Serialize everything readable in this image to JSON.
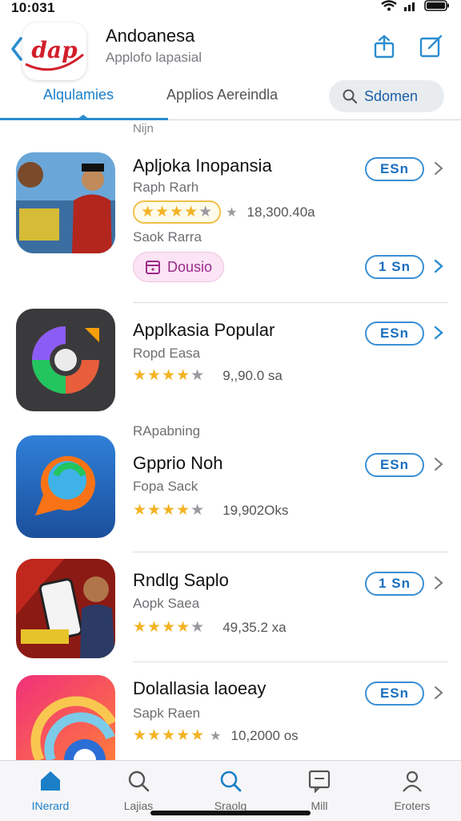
{
  "status_bar": {
    "time": "10:031"
  },
  "header": {
    "title": "Andoanesa",
    "subtitle": "Applofo lapasial",
    "logo_text": "dap"
  },
  "tabs": [
    {
      "label": "Alqulamies",
      "active": true
    },
    {
      "label": "Applios Aereindla",
      "active": false
    }
  ],
  "search": {
    "label": "Sdomen"
  },
  "section_top_label": "Nijn",
  "apps": [
    {
      "name": "Apljoka Inopansia",
      "developer": "Raph Rarh",
      "rating": 4.5,
      "rating_count": "18,300.40a",
      "sub_label": "Saok Rarra",
      "tag": "Dousio",
      "get_label": "ESn",
      "secondary_get_label": "1 Sn",
      "icon": "character-poster-icon"
    },
    {
      "name": "Applkasia Popular",
      "developer": "Ropd Easa",
      "rating": 4.5,
      "rating_count": "9,,90.0 sa",
      "get_label": "ESn",
      "icon": "colorful-circle-logo-icon"
    },
    {
      "name": "Gpprio Noh",
      "developer": "Fopa Sack",
      "rating": 4.5,
      "rating_count": "19,902Oks",
      "section_label": "RApabning",
      "get_label": "ESn",
      "icon": "blue-orange-chat-icon"
    },
    {
      "name": "Rndlg Saplo",
      "developer": "Aopk Saea",
      "rating": 4.5,
      "rating_count": "49,35.2 xa",
      "get_label": "1 Sn",
      "icon": "phone-promo-icon"
    },
    {
      "name": "Dolallasia laoeay",
      "developer": "Sapk Raen",
      "rating": 5,
      "rating_count": "10,2000 os",
      "get_label": "ESn",
      "icon": "rainbow-swirl-icon"
    }
  ],
  "tab_bar": [
    {
      "label": "INerard",
      "icon": "home-icon",
      "active": true
    },
    {
      "label": "Lajias",
      "icon": "search-icon",
      "active": false
    },
    {
      "label": "Sraolg",
      "icon": "search-icon",
      "active": false
    },
    {
      "label": "Mill",
      "icon": "message-icon",
      "active": false
    },
    {
      "label": "Eroters",
      "icon": "person-icon",
      "active": false
    }
  ],
  "colors": {
    "accent": "#2a8dd0",
    "star": "#f3b323",
    "tag": "#9b2b8a"
  }
}
